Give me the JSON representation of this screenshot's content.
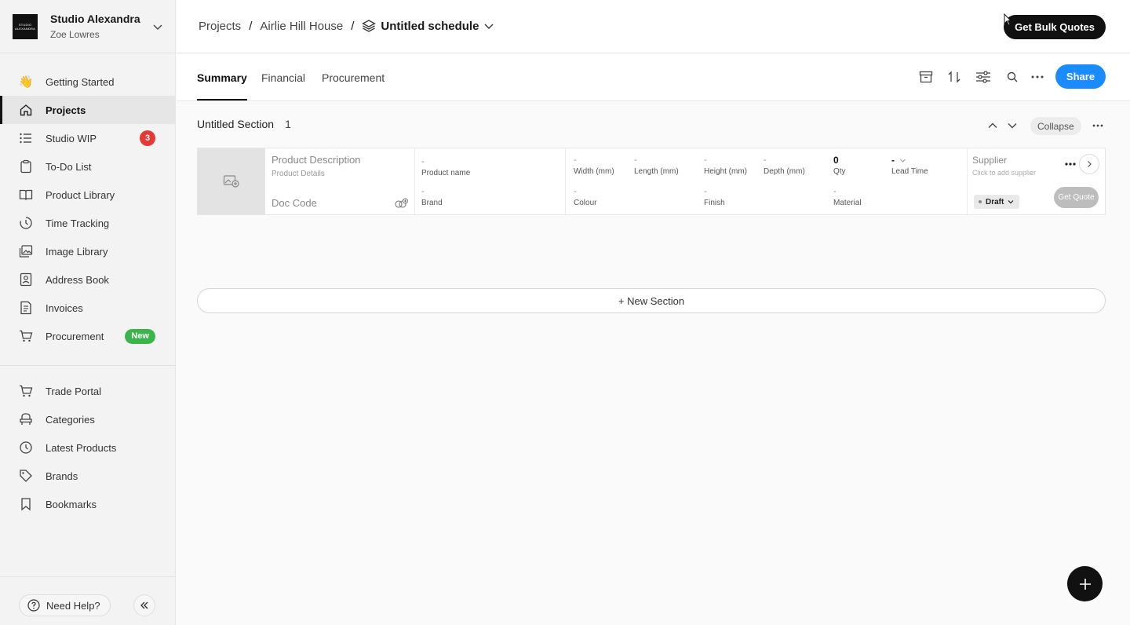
{
  "workspace": {
    "logo_text": "STUDIO ALEXANDRA",
    "name": "Studio Alexandra",
    "user": "Zoe Lowres"
  },
  "sidebar": {
    "items": [
      {
        "label": "Getting Started",
        "icon": "wave-hand-icon"
      },
      {
        "label": "Projects",
        "icon": "home-icon",
        "active": true
      },
      {
        "label": "Studio WIP",
        "icon": "list-icon",
        "badge": "3"
      },
      {
        "label": "To-Do List",
        "icon": "clipboard-icon"
      },
      {
        "label": "Product Library",
        "icon": "book-icon"
      },
      {
        "label": "Time Tracking",
        "icon": "clock-icon"
      },
      {
        "label": "Image Library",
        "icon": "image-icon"
      },
      {
        "label": "Address Book",
        "icon": "contact-icon"
      },
      {
        "label": "Invoices",
        "icon": "invoice-icon"
      },
      {
        "label": "Procurement",
        "icon": "cart-icon",
        "badge": "New"
      }
    ],
    "secondary": [
      {
        "label": "Trade Portal",
        "icon": "cart-icon"
      },
      {
        "label": "Categories",
        "icon": "chair-icon"
      },
      {
        "label": "Latest Products",
        "icon": "clock-icon"
      },
      {
        "label": "Brands",
        "icon": "tag-icon"
      },
      {
        "label": "Bookmarks",
        "icon": "bookmark-icon"
      }
    ],
    "help_label": "Need Help?"
  },
  "breadcrumb": {
    "root": "Projects",
    "project": "Airlie Hill House",
    "current": "Untitled schedule",
    "separator": "/"
  },
  "header": {
    "bulk_quotes_label": "Get Bulk Quotes",
    "share_label": "Share"
  },
  "tabs": [
    {
      "label": "Summary",
      "active": true
    },
    {
      "label": "Financial"
    },
    {
      "label": "Procurement"
    }
  ],
  "section": {
    "title": "Untitled Section",
    "count": "1",
    "collapse_label": "Collapse",
    "new_section_label": "+ New Section"
  },
  "product": {
    "description": "Product Description",
    "details": "Product Details",
    "doc_code": "Doc Code",
    "product_name_value": "-",
    "product_name_label": "Product name",
    "brand_value": "-",
    "brand_label": "Brand",
    "width_value": "-",
    "width_label": "Width (mm)",
    "length_value": "-",
    "length_label": "Length (mm)",
    "height_value": "-",
    "height_label": "Height (mm)",
    "depth_value": "-",
    "depth_label": "Depth (mm)",
    "qty_value": "0",
    "qty_label": "Qty",
    "lead_value": "-",
    "lead_label": "Lead Time",
    "colour_value": "-",
    "colour_label": "Colour",
    "finish_value": "-",
    "finish_label": "Finish",
    "material_value": "-",
    "material_label": "Material",
    "supplier_label": "Supplier",
    "supplier_hint": "Click to add supplier",
    "status": "Draft",
    "quote_label": "Get Quote"
  },
  "colors": {
    "accent": "#1a8cff",
    "dark": "#111111",
    "badge_red": "#e53935",
    "badge_green": "#3bb54a"
  }
}
